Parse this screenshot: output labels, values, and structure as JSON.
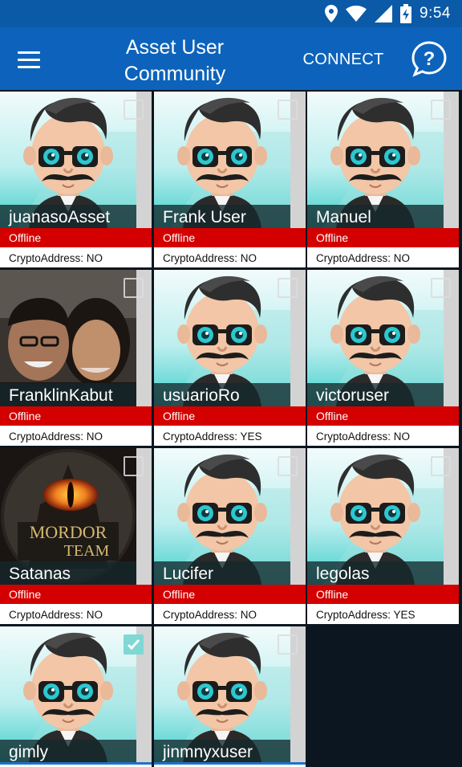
{
  "status_bar": {
    "time": "9:54",
    "icons": [
      "location-icon",
      "wifi-icon",
      "signal-icon",
      "battery-charging-icon"
    ]
  },
  "app_bar": {
    "title_line1": "Asset User",
    "title_line2": "Community",
    "connect_label": "CONNECT",
    "menu_icon": "hamburger-menu-icon",
    "help_icon": "help-question-icon"
  },
  "users": [
    {
      "name": "juanasoAsset",
      "status": "Offline",
      "crypto": "CryptoAddress: NO",
      "avatar": "cartoon",
      "checked": false
    },
    {
      "name": "Frank User",
      "status": "Offline",
      "crypto": "CryptoAddress: NO",
      "avatar": "cartoon",
      "checked": false
    },
    {
      "name": "Manuel",
      "status": "Offline",
      "crypto": "CryptoAddress: NO",
      "avatar": "cartoon",
      "checked": false
    },
    {
      "name": "FranklinKabut",
      "status": "Offline",
      "crypto": "CryptoAddress: NO",
      "avatar": "photo",
      "checked": false
    },
    {
      "name": "usuarioRo",
      "status": "Offline",
      "crypto": "CryptoAddress: YES",
      "avatar": "cartoon",
      "checked": false
    },
    {
      "name": "victoruser",
      "status": "Offline",
      "crypto": "CryptoAddress: NO",
      "avatar": "cartoon",
      "checked": false
    },
    {
      "name": "Satanas",
      "status": "Offline",
      "crypto": "CryptoAddress: NO",
      "avatar": "mordor",
      "checked": false,
      "logo_text_1": "MORDOR",
      "logo_text_2": "TEAM"
    },
    {
      "name": "Lucifer",
      "status": "Offline",
      "crypto": "CryptoAddress: NO",
      "avatar": "cartoon",
      "checked": false
    },
    {
      "name": "legolas",
      "status": "Offline",
      "crypto": "CryptoAddress: YES",
      "avatar": "cartoon",
      "checked": false
    },
    {
      "name": "gimly",
      "status": "",
      "crypto": "",
      "avatar": "cartoon",
      "checked": true
    },
    {
      "name": "jinmnyxuser",
      "status": "",
      "crypto": "",
      "avatar": "cartoon",
      "checked": false
    }
  ],
  "colors": {
    "status_bar": "#0b5aa8",
    "app_bar": "#0d63bb",
    "offline_red": "#d40000",
    "background": "#0b1620",
    "avatar_teal": "#3fcfcb"
  }
}
